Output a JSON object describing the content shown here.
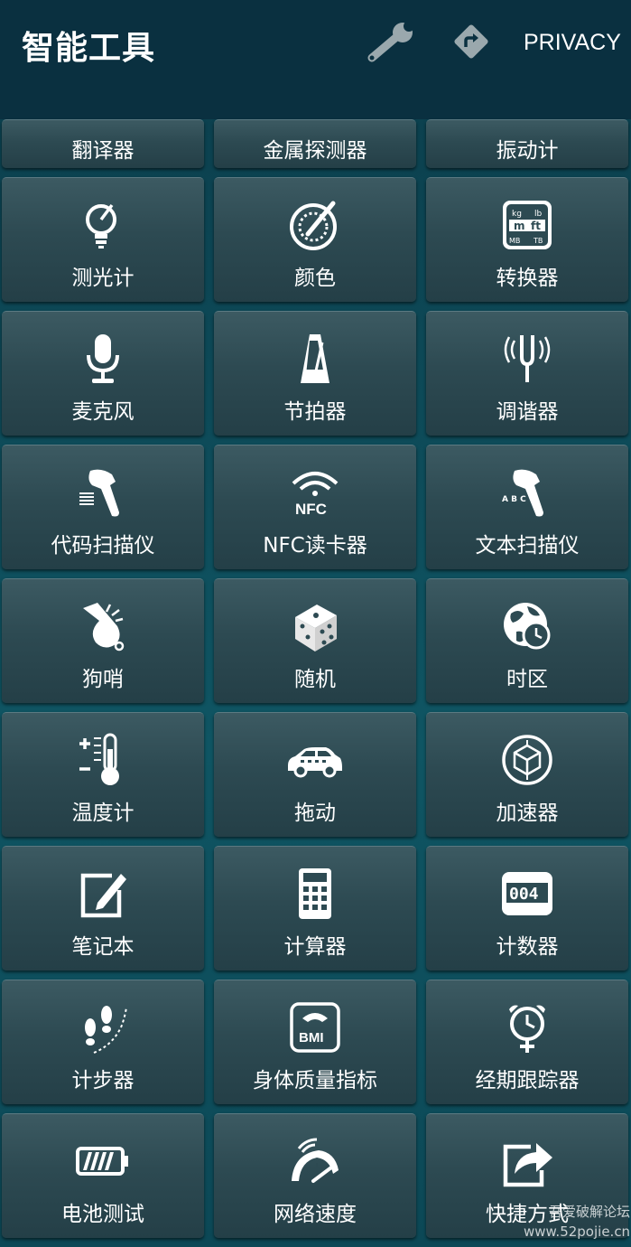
{
  "header": {
    "title": "智能工具",
    "wrench_icon": "wrench-icon",
    "directions_icon": "directions-icon",
    "privacy_label": "PRIVACY"
  },
  "tools": [
    {
      "label": "翻译器",
      "icon": ""
    },
    {
      "label": "金属探测器",
      "icon": ""
    },
    {
      "label": "振动计",
      "icon": ""
    },
    {
      "label": "测光计",
      "icon": "light-meter-icon"
    },
    {
      "label": "颜色",
      "icon": "color-dial-icon"
    },
    {
      "label": "转换器",
      "icon": "unit-converter-icon"
    },
    {
      "label": "麦克风",
      "icon": "microphone-icon"
    },
    {
      "label": "节拍器",
      "icon": "metronome-icon"
    },
    {
      "label": "调谐器",
      "icon": "tuning-fork-icon"
    },
    {
      "label": "代码扫描仪",
      "icon": "barcode-scanner-icon"
    },
    {
      "label": "NFC读卡器",
      "icon": "nfc-icon"
    },
    {
      "label": "文本扫描仪",
      "icon": "text-scanner-icon"
    },
    {
      "label": "狗哨",
      "icon": "whistle-icon"
    },
    {
      "label": "随机",
      "icon": "dice-icon"
    },
    {
      "label": "时区",
      "icon": "globe-clock-icon"
    },
    {
      "label": "温度计",
      "icon": "thermometer-icon"
    },
    {
      "label": "拖动",
      "icon": "car-icon"
    },
    {
      "label": "加速器",
      "icon": "accelerometer-cube-icon"
    },
    {
      "label": "笔记本",
      "icon": "notepad-edit-icon"
    },
    {
      "label": "计算器",
      "icon": "calculator-icon"
    },
    {
      "label": "计数器",
      "icon": "counter-icon"
    },
    {
      "label": "计步器",
      "icon": "footsteps-icon"
    },
    {
      "label": "身体质量指标",
      "icon": "bmi-scale-icon"
    },
    {
      "label": "经期跟踪器",
      "icon": "alarm-venus-icon"
    },
    {
      "label": "电池测试",
      "icon": "battery-icon"
    },
    {
      "label": "网络速度",
      "icon": "speedometer-icon"
    },
    {
      "label": "快捷方式",
      "icon": "share-icon"
    }
  ],
  "icon_text": {
    "unit_kg": "kg",
    "unit_lb": "lb",
    "unit_m": "m",
    "unit_ft": "ft",
    "unit_mb": "MB",
    "unit_tb": "TB",
    "nfc": "NFC",
    "bmi": "BMI",
    "counter_digits": "004",
    "abc": "A B C"
  },
  "watermark": {
    "line1": "吾爱破解论坛",
    "line2": "www.52pojie.cn"
  },
  "colors": {
    "topbar": "#0a3040",
    "background": "#0f5563",
    "tile": "#2d4a52",
    "text": "#ffffff",
    "icon_gray": "#9aa8ad"
  }
}
